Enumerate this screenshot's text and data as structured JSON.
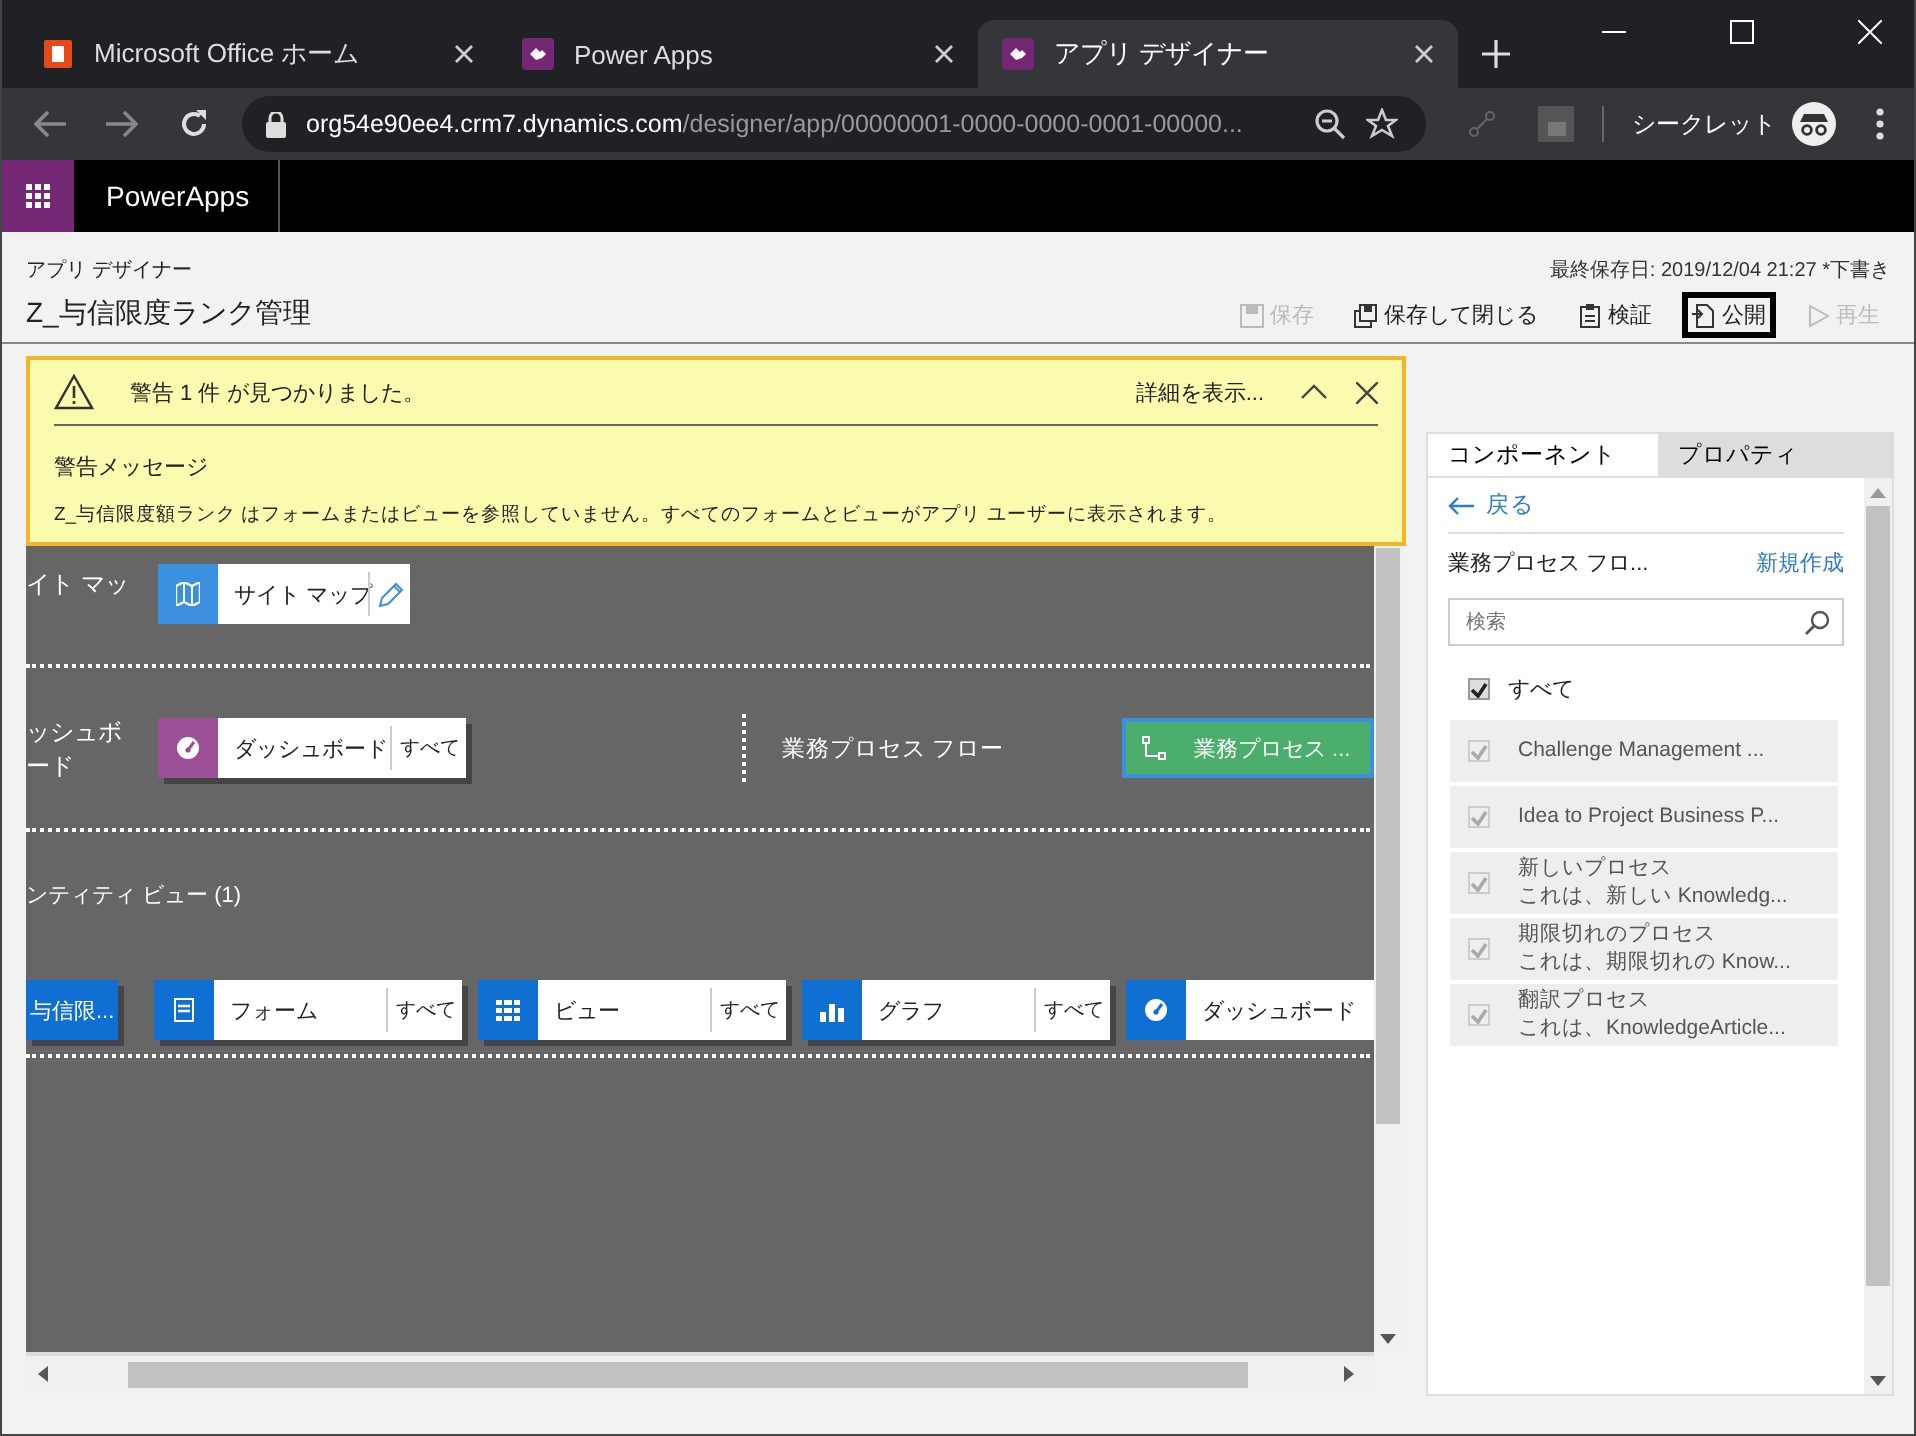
{
  "browser": {
    "tabs": [
      {
        "title": "Microsoft Office ホーム",
        "selected": false
      },
      {
        "title": "Power Apps",
        "selected": false
      },
      {
        "title": "アプリ デザイナー",
        "selected": true
      }
    ],
    "url_host": "org54e90ee4.crm7.dynamics.com",
    "url_path": "/designer/app/00000001-0000-0000-0001-00000...",
    "profile": "シークレット"
  },
  "app_bar": {
    "title": "PowerApps"
  },
  "header": {
    "subtitle": "アプリ デザイナー",
    "title": "Z_与信限度ランク管理",
    "saved": "最終保存日: 2019/12/04 21:27 *下書き",
    "actions": [
      {
        "label": "保存",
        "disabled": true,
        "highlighted": false
      },
      {
        "label": "保存して閉じる",
        "disabled": false,
        "highlighted": false
      },
      {
        "label": "検証",
        "disabled": false,
        "highlighted": false
      },
      {
        "label": "公開",
        "disabled": false,
        "highlighted": true
      },
      {
        "label": "再生",
        "disabled": true,
        "highlighted": false
      }
    ]
  },
  "warning": {
    "summary": "警告 1 件 が見つかりました。",
    "details_link": "詳細を表示...",
    "heading": "警告メッセージ",
    "message": "Z_与信限度額ランク はフォームまたはビューを参照していません。すべてのフォームとビューがアプリ ユーザーに表示されます。"
  },
  "canvas": {
    "sections": [
      {
        "kind": "inline",
        "label": "イト マッ",
        "tiles": [
          {
            "kind": "sitemap",
            "color": "#3a8fde",
            "label": "サイト マップ"
          }
        ]
      },
      {
        "kind": "inline",
        "label": "ッシュボード",
        "tiles": [
          {
            "kind": "dashboard",
            "color": "#9b4f96",
            "label": "ダッシュボード",
            "filter": "すべて"
          }
        ],
        "group": {
          "label": "業務プロセス フロー",
          "tiles": [
            {
              "kind": "process",
              "label": "業務プロセス ..."
            }
          ]
        }
      },
      {
        "kind": "stacked",
        "label": "ンティティ ビュー (1)",
        "tiles": [
          {
            "kind": "entity",
            "label": "与信限..."
          },
          {
            "kind": "form",
            "color": "#0f6fd2",
            "label": "フォーム",
            "filter": "すべて"
          },
          {
            "kind": "view",
            "color": "#0f6fd2",
            "label": "ビュー",
            "filter": "すべて"
          },
          {
            "kind": "chart",
            "color": "#0f6fd2",
            "label": "グラフ",
            "filter": "すべて"
          },
          {
            "kind": "dashboard",
            "color": "#0f6fd2",
            "label": "ダッシュボード"
          }
        ]
      }
    ]
  },
  "panel": {
    "tabs": [
      {
        "label": "コンポーネント",
        "selected": true
      },
      {
        "label": "プロパティ",
        "selected": false
      }
    ],
    "back": "戻る",
    "list_title": "業務プロセス フロ...",
    "new_link": "新規作成",
    "search": {
      "placeholder": "検索"
    },
    "select_all": {
      "label": "すべて",
      "checked": true
    },
    "items": [
      {
        "title": "Challenge Management ...",
        "checked": true,
        "disabled": true
      },
      {
        "title": "Idea to Project Business P...",
        "checked": true,
        "disabled": true
      },
      {
        "title": "新しいプロセス",
        "description": "これは、新しい Knowledg...",
        "checked": true,
        "disabled": true
      },
      {
        "title": "期限切れのプロセス",
        "description": "これは、期限切れの Know...",
        "checked": true,
        "disabled": true
      },
      {
        "title": "翻訳プロセス",
        "description": "これは、KnowledgeArticle...",
        "checked": true,
        "disabled": true
      }
    ]
  }
}
